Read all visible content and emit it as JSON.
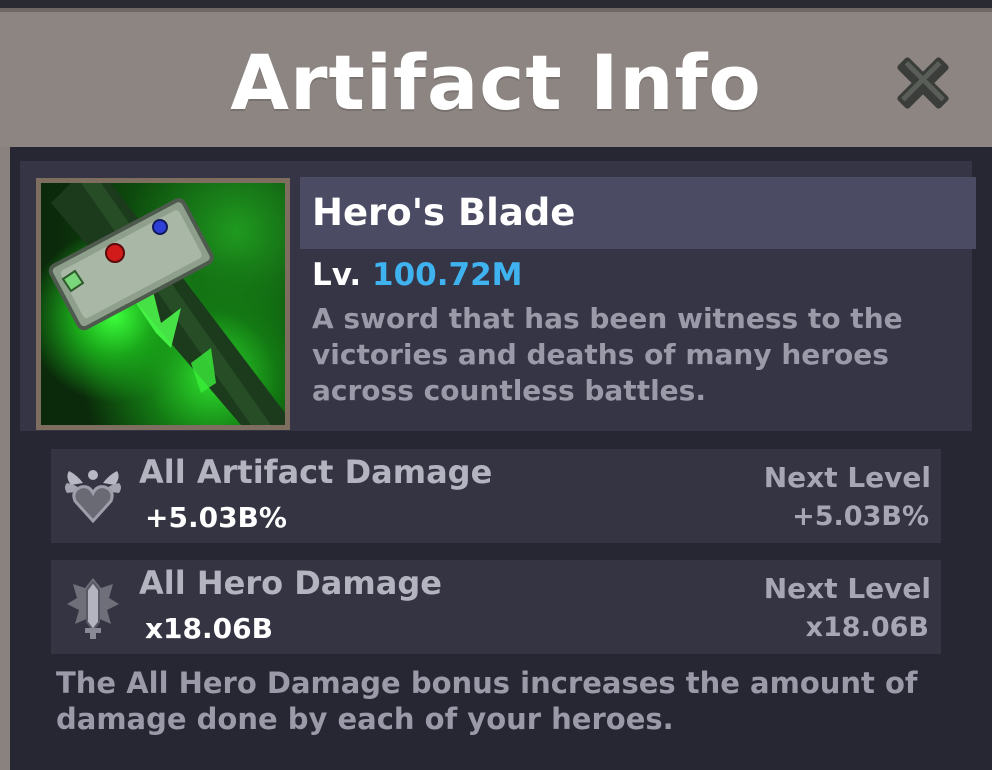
{
  "window": {
    "title": "Artifact Info",
    "close_icon": "close-icon"
  },
  "artifact": {
    "name": "Hero's Blade",
    "level_prefix": "Lv.",
    "level_value": "100.72M",
    "description": "A sword that has been witness to the victories and deaths of many heroes across countless battles.",
    "image_icon": "green-sword-icon"
  },
  "stats": [
    {
      "icon": "heart-wings-icon",
      "name": "All Artifact Damage",
      "value": "+5.03B%",
      "next_label": "Next Level",
      "next_value": "+5.03B%"
    },
    {
      "icon": "sword-emblem-icon",
      "name": "All Hero Damage",
      "value": "x18.06B",
      "next_label": "Next Level",
      "next_value": "x18.06B"
    }
  ],
  "footer_note": "The All Hero Damage bonus increases the amount of damage done by each of your heroes.",
  "colors": {
    "level_accent": "#3fb2f0",
    "panel_bg": "#272733",
    "header_bg": "#8d8582"
  }
}
